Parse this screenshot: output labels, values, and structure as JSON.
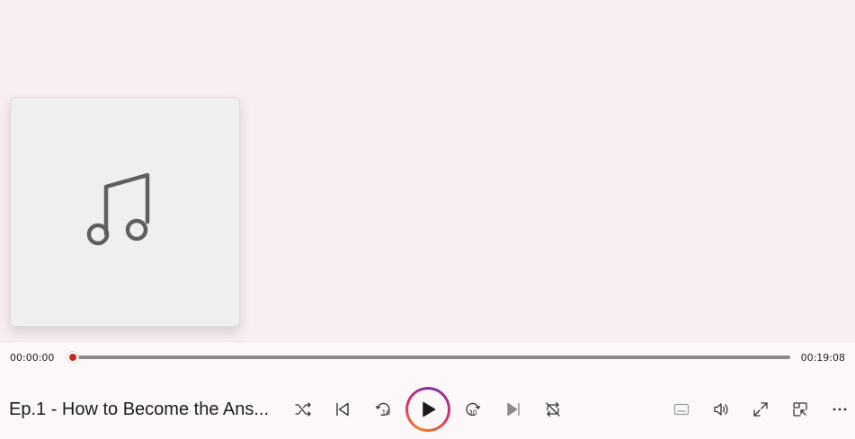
{
  "player": {
    "elapsed": "00:00:00",
    "total": "00:19:08",
    "progress_fraction": 0.0,
    "track_title": "Ep.1 - How to Become the Ans..."
  },
  "colors": {
    "accent": "#c42b1c",
    "background": "#f9eef4",
    "controls_background": "#fcf8fa"
  },
  "icons": {
    "album_placeholder": "music-note-icon",
    "shuffle": "shuffle-icon",
    "previous": "previous-icon",
    "skip_back": "skip-back-10-icon",
    "play": "play-icon",
    "skip_forward": "skip-forward-30-icon",
    "next": "next-icon",
    "repeat": "repeat-icon",
    "captions": "captions-icon",
    "volume": "volume-icon",
    "fullscreen": "fullscreen-icon",
    "mini_player": "mini-player-icon",
    "more": "more-options-icon"
  },
  "labels": {
    "skip_back_seconds": "10",
    "skip_forward_seconds": "30"
  }
}
